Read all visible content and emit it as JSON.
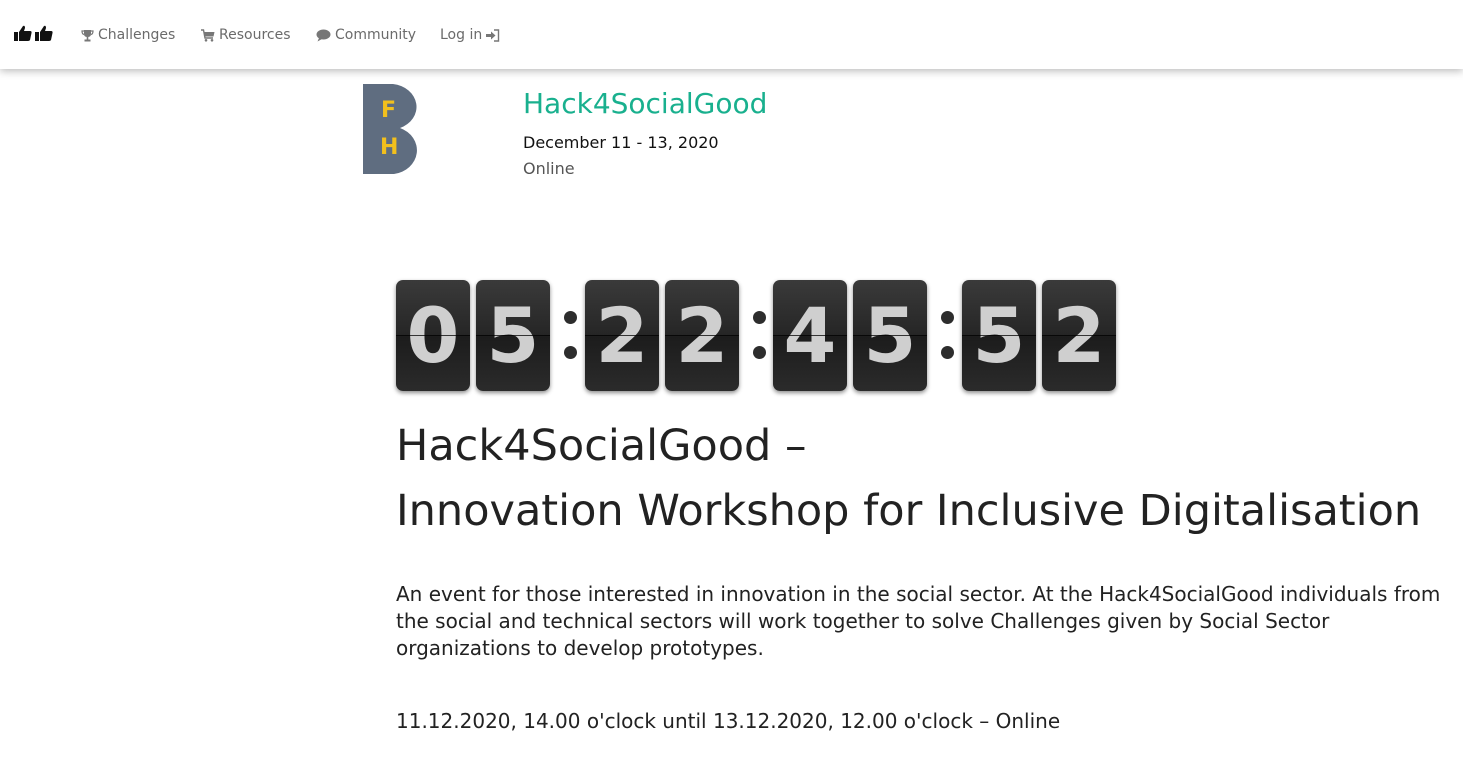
{
  "nav": {
    "brand_icon": "thumbs-up-icon",
    "items": [
      {
        "label": "Challenges",
        "icon": "trophy-icon"
      },
      {
        "label": "Resources",
        "icon": "cart-icon"
      },
      {
        "label": "Community",
        "icon": "comment-icon"
      },
      {
        "label": "Log in",
        "icon": "sign-in-icon"
      }
    ]
  },
  "event": {
    "logo_letters": [
      "F",
      "H"
    ],
    "title": "Hack4SocialGood",
    "dates": "December 11 - 13, 2020",
    "location": "Online"
  },
  "countdown": {
    "digits": [
      "0",
      "5",
      "2",
      "2",
      "4",
      "5",
      "5",
      "2"
    ],
    "separator": ":"
  },
  "content": {
    "heading_line1": "Hack4SocialGood –",
    "heading_line2": "Innovation Workshop for Inclusive Digitalisation",
    "description": "An event for those interested in innovation in the social sector. At the Hack4SocialGood individuals from the social and technical sectors will work together to solve Challenges given by Social Sector organizations to develop prototypes.",
    "schedule": "11.12.2020, 14.00 o'clock until 13.12.2020, 12.00 o'clock – Online"
  },
  "colors": {
    "accent": "#19b08e",
    "logo_background": "#5f6d80",
    "logo_letters": "#f2c01d",
    "clock_card": "#2b2b2b",
    "clock_digit": "#cfcfcf",
    "nav_text": "#6b6b6b"
  }
}
